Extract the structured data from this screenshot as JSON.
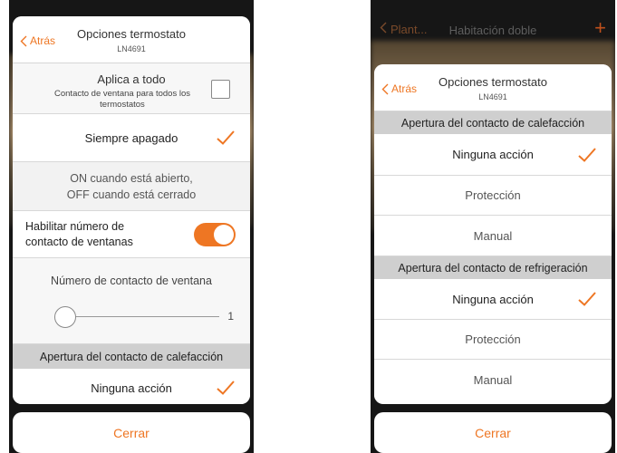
{
  "colors": {
    "accent": "#ee7623",
    "section_bg": "#cfcfcf"
  },
  "left": {
    "modal": {
      "back_label": "Atrás",
      "title": "Opciones termostato",
      "subtitle": "LN4691"
    },
    "apply": {
      "title": "Aplica a todo",
      "desc": "Contacto de ventana para todos los termostatos",
      "checked": false
    },
    "options": {
      "always_off": "Siempre apagado",
      "on_open_line1": "ON cuando está abierto,",
      "on_open_line2": "OFF cuando está cerrado"
    },
    "toggle": {
      "label_line1": "Habilitar número de",
      "label_line2": "contacto de ventanas",
      "on": true
    },
    "slider": {
      "label": "Número de contacto de ventana",
      "value": "1"
    },
    "section_heating": "Apertura del contacto de calefacción",
    "heating_first": "Ninguna acción",
    "close_label": "Cerrar"
  },
  "right": {
    "bg": {
      "back_label": "Plant...",
      "title": "Habitación doble",
      "plus": "+"
    },
    "modal": {
      "back_label": "Atrás",
      "title": "Opciones termostato",
      "subtitle": "LN4691"
    },
    "section_heating": "Apertura del contacto de calefacción",
    "heating_options": [
      "Ninguna acción",
      "Protección",
      "Manual"
    ],
    "section_cooling": "Apertura del contacto de refrigeración",
    "cooling_options": [
      "Ninguna acción",
      "Protección",
      "Manual"
    ],
    "close_label": "Cerrar"
  },
  "icons": {
    "back": "chevron-left-icon",
    "check": "checkmark-icon",
    "add": "plus-icon"
  }
}
